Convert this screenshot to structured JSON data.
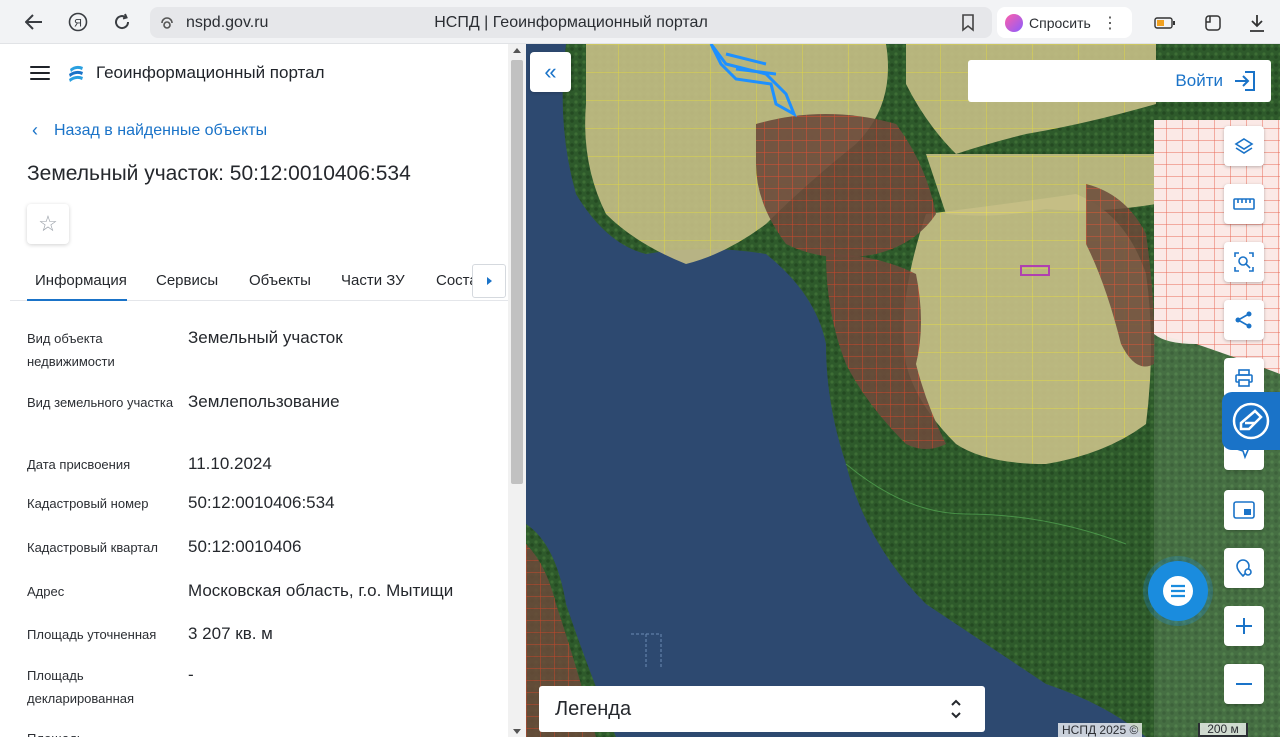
{
  "browser": {
    "url": "nspd.gov.ru",
    "tab_title": "НСПД | Геоинформационный портал",
    "ask_label": "Спросить"
  },
  "portal": {
    "name": "Геоинформационный портал",
    "back_link": "Назад в найденные объекты",
    "object_title": "Земельный участок: 50:12:0010406:534"
  },
  "tabs": [
    {
      "label": "Информация",
      "active": true
    },
    {
      "label": "Сервисы"
    },
    {
      "label": "Объекты"
    },
    {
      "label": "Части ЗУ"
    },
    {
      "label": "Соста"
    }
  ],
  "properties": [
    {
      "label": "Вид объекта недвижимости",
      "value": "Земельный участок"
    },
    {
      "label": "Вид земельного участка",
      "value": "Землепользование"
    },
    {
      "label": "Дата присвоения",
      "value": "11.10.2024"
    },
    {
      "label": "Кадастровый номер",
      "value": "50:12:0010406:534"
    },
    {
      "label": "Кадастровый квартал",
      "value": "50:12:0010406"
    },
    {
      "label": "Адрес",
      "value": "Московская область, г.о. Мытищи"
    },
    {
      "label": "Площадь уточненная",
      "value": "3 207 кв. м"
    },
    {
      "label": "Площадь декларированная",
      "value": "-"
    },
    {
      "label": "Площадь",
      "value": "-"
    }
  ],
  "map": {
    "login_label": "Войти",
    "legend_label": "Легенда",
    "copyright": "НСПД 2025 ©",
    "scale_label": "200 м",
    "tools": [
      "layers-icon",
      "ruler-icon",
      "select-area-icon",
      "share-icon",
      "print-icon",
      "navigate-icon",
      "minimap-icon",
      "location-icon",
      "zoom-in-icon",
      "zoom-out-icon"
    ]
  },
  "colors": {
    "accent": "#1a73c8",
    "water": "#2d4970",
    "forest": "#2f5a2c",
    "field": "#c9c38a",
    "parcel_line_yellow": "#f2e34a",
    "parcel_line_red": "#e0452b",
    "selected_parcel": "#b040b0"
  }
}
